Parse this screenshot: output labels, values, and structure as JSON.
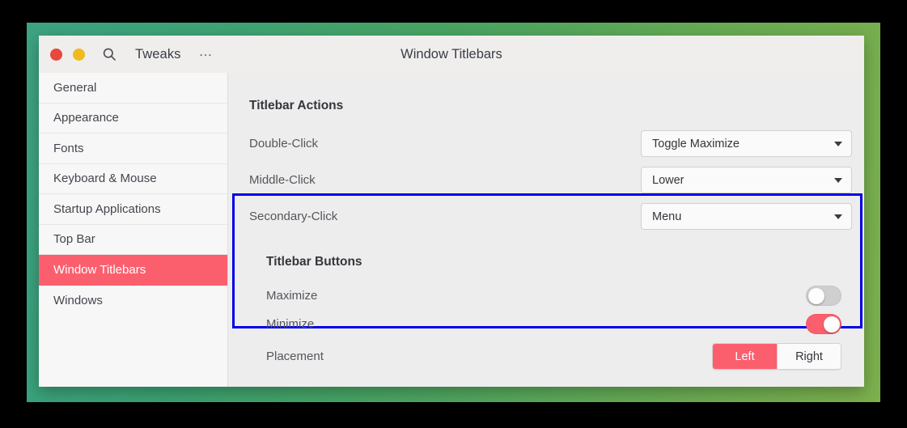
{
  "window": {
    "app_name": "Tweaks",
    "title": "Window Titlebars",
    "overflow_menu": "…",
    "controls": {
      "close_color": "#e8483c",
      "minimize_color": "#efbb1e"
    }
  },
  "theme": {
    "accent": "#fb5f6e",
    "highlight_border": "#0000e8",
    "window_bg": "#f0efee",
    "sidebar_bg": "#f7f7f7",
    "content_bg": "#eeeded",
    "wallpaper_from": "#2e9c79",
    "wallpaper_to": "#7cb04d"
  },
  "sidebar": {
    "items": [
      {
        "label": "General",
        "selected": false
      },
      {
        "label": "Appearance",
        "selected": false
      },
      {
        "label": "Fonts",
        "selected": false
      },
      {
        "label": "Keyboard & Mouse",
        "selected": false
      },
      {
        "label": "Startup Applications",
        "selected": false
      },
      {
        "label": "Top Bar",
        "selected": false
      },
      {
        "label": "Window Titlebars",
        "selected": true
      },
      {
        "label": "Windows",
        "selected": false
      }
    ]
  },
  "content": {
    "actions_group": {
      "title": "Titlebar Actions",
      "rows": [
        {
          "label": "Double-Click",
          "value": "Toggle Maximize"
        },
        {
          "label": "Middle-Click",
          "value": "Lower"
        },
        {
          "label": "Secondary-Click",
          "value": "Menu"
        }
      ]
    },
    "buttons_group": {
      "title": "Titlebar Buttons",
      "highlighted": true,
      "maximize": {
        "label": "Maximize",
        "state": "off"
      },
      "minimize": {
        "label": "Minimize",
        "state": "on"
      },
      "placement": {
        "label": "Placement",
        "options": [
          "Left",
          "Right"
        ],
        "selected": "Left"
      }
    }
  }
}
